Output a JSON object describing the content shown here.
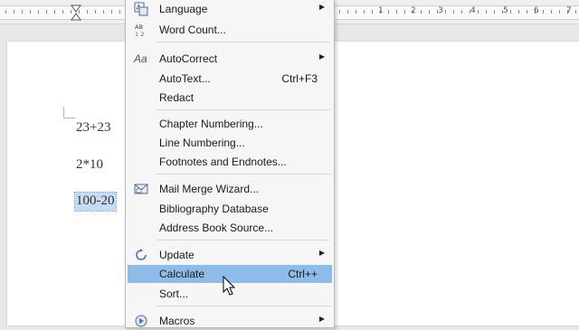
{
  "ruler": {
    "numbers": [
      "1",
      "2",
      "3",
      "4",
      "5",
      "6",
      "7"
    ]
  },
  "document": {
    "lines": [
      "23+23",
      "2*10",
      "100-20"
    ]
  },
  "menu": {
    "language": "Language",
    "word_count": "Word Count...",
    "autocorrect": "AutoCorrect",
    "autotext": "AutoText...",
    "autotext_shortcut": "Ctrl+F3",
    "redact": "Redact",
    "chapter_numbering": "Chapter Numbering...",
    "line_numbering": "Line Numbering...",
    "footnotes": "Footnotes and Endnotes...",
    "mail_merge": "Mail Merge Wizard...",
    "bibliography": "Bibliography Database",
    "address_book": "Address Book Source...",
    "update": "Update",
    "calculate": "Calculate",
    "calculate_shortcut": "Ctrl++",
    "sort": "Sort...",
    "macros": "Macros",
    "icon_ab12": "AB 1 2",
    "icon_aa": "Aa",
    "highlight_color": "#8fbbe8"
  }
}
